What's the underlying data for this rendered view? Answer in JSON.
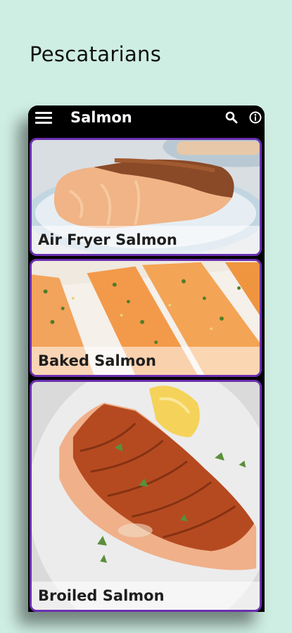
{
  "promo": {
    "title": "Pescatarians"
  },
  "appbar": {
    "title": "Salmon",
    "icons": [
      "menu-icon",
      "search-icon",
      "info-icon"
    ]
  },
  "cards": [
    {
      "label": "Air Fryer Salmon"
    },
    {
      "label": "Baked Salmon"
    },
    {
      "label": "Broiled Salmon"
    }
  ],
  "colors": {
    "background": "#cfeee3",
    "appbar": "#000000",
    "card_border": "#6a2fb0",
    "text": "#111111"
  }
}
